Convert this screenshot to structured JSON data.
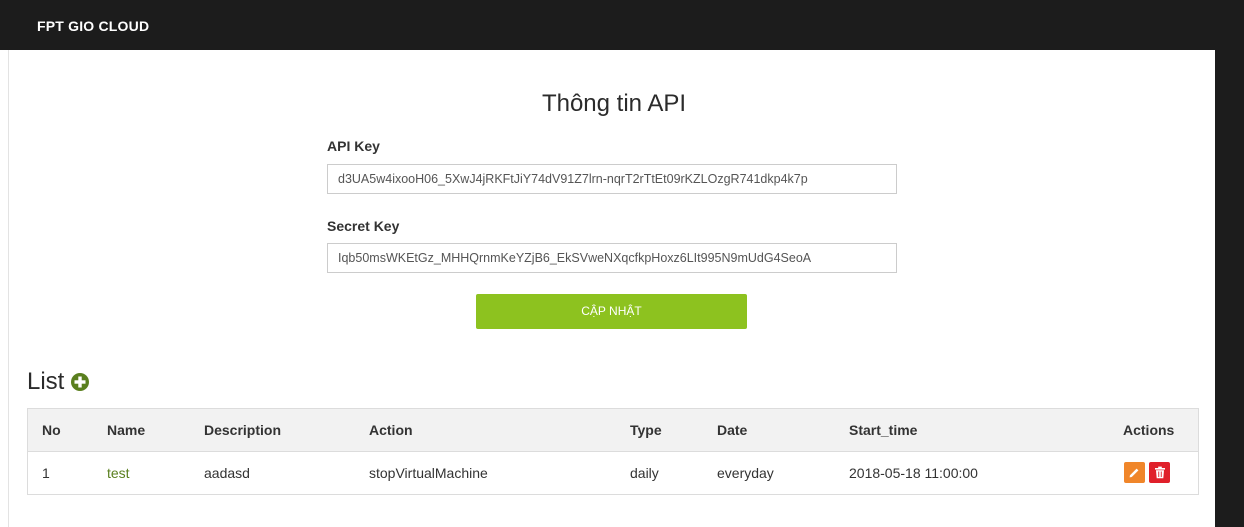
{
  "header": {
    "brand": "FPT GIO CLOUD"
  },
  "api_section": {
    "title": "Thông tin API",
    "api_key_label": "API Key",
    "api_key_value": "d3UA5w4ixooH06_5XwJ4jRKFtJiY74dV91Z7lrn-nqrT2rTtEt09rKZLOzgR741dkp4k7p",
    "secret_key_label": "Secret Key",
    "secret_key_value": "Iqb50msWKEtGz_MHHQrnmKeYZjB6_EkSVweNXqcfkpHoxz6LIt995N9mUdG4SeoA",
    "update_label": "CẬP NHẬT"
  },
  "list_section": {
    "title": "List",
    "columns": [
      "No",
      "Name",
      "Description",
      "Action",
      "Type",
      "Date",
      "Start_time",
      "Actions"
    ],
    "rows": [
      {
        "no": "1",
        "name": "test",
        "description": "aadasd",
        "action": "stopVirtualMachine",
        "type": "daily",
        "date": "everyday",
        "start_time": "2018-05-18 11:00:00"
      }
    ]
  },
  "icons": {
    "add": "plus-circle-icon",
    "edit": "pencil-icon",
    "delete": "trash-icon"
  },
  "colors": {
    "header_bg": "#1c1c1c",
    "accent_green": "#8dc21f",
    "link_green": "#5a7f1e",
    "edit_orange": "#f0862a",
    "delete_red": "#e0202a"
  }
}
